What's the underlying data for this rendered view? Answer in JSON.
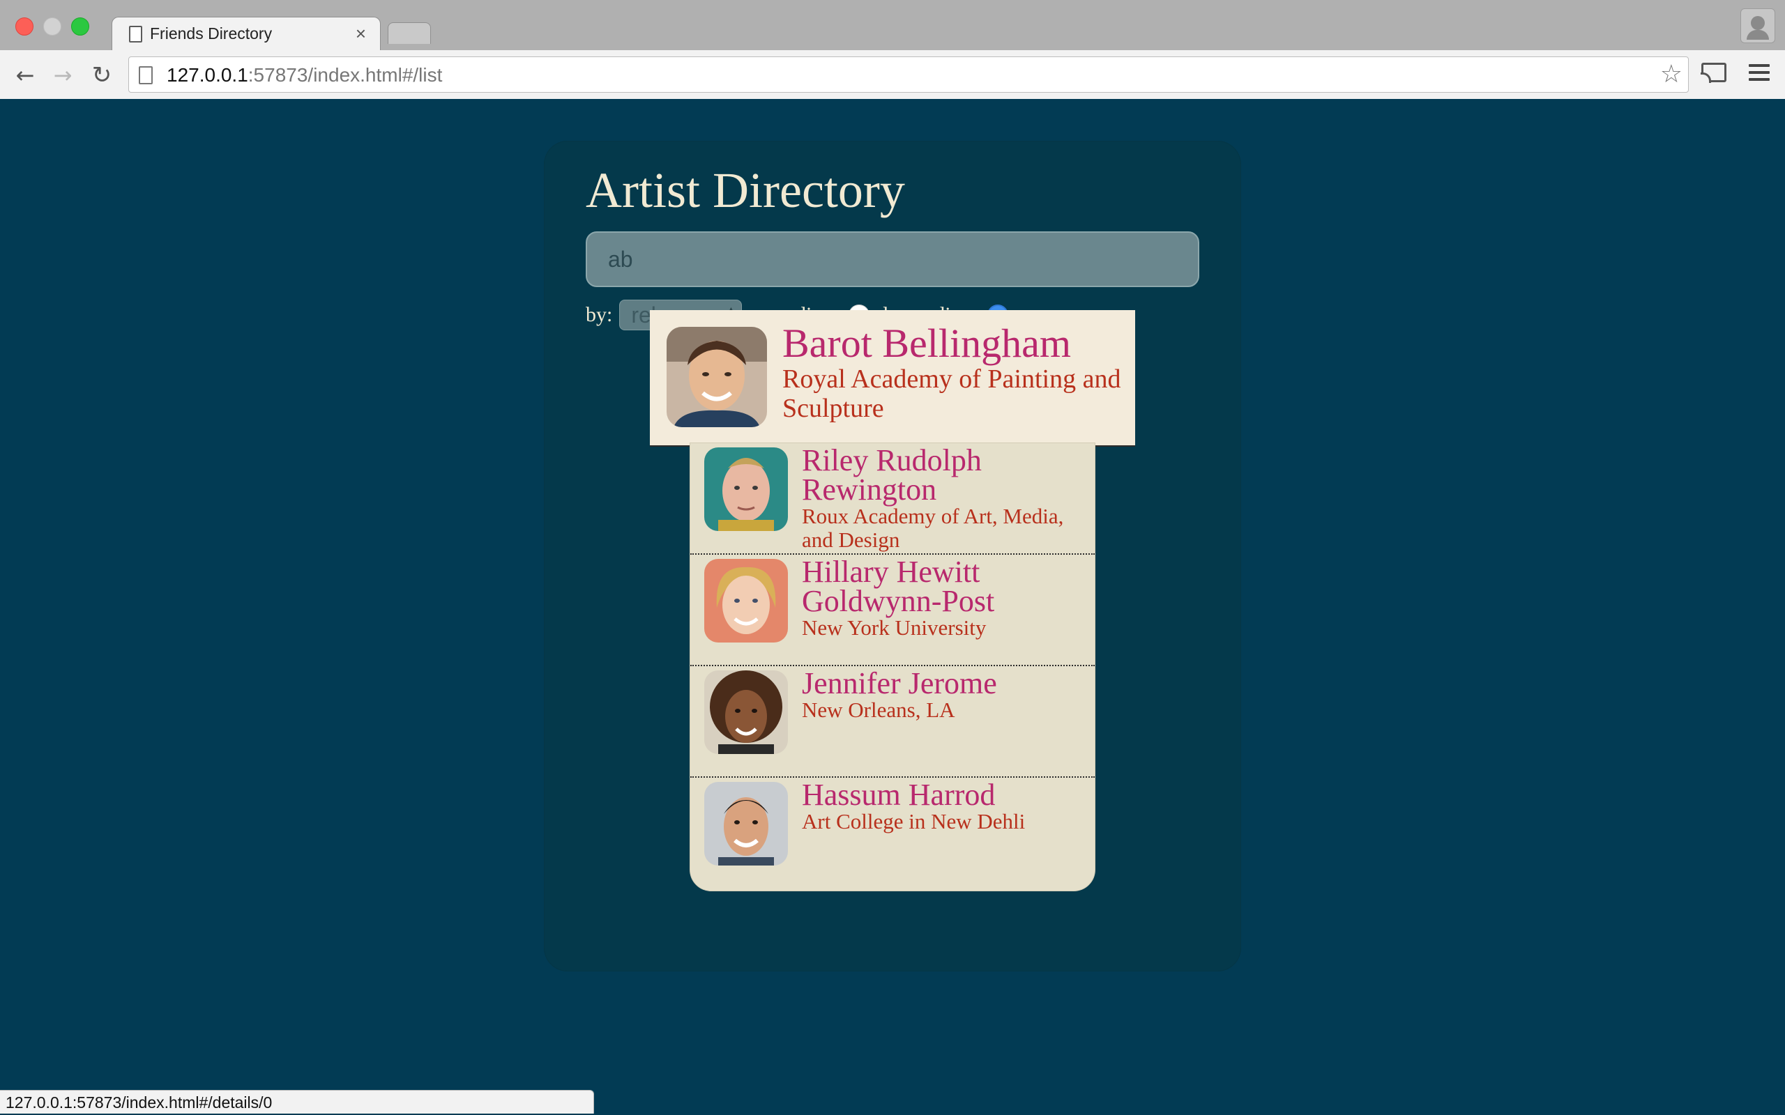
{
  "browser": {
    "tab_title": "Friends Directory",
    "tab_close": "×",
    "url_host": "127.0.0.1",
    "url_rest": ":57873/index.html#/list",
    "status_url": "127.0.0.1:57873/index.html#/details/0",
    "icons": [
      "back-arrow-icon",
      "forward-arrow-icon",
      "reload-icon",
      "page-icon",
      "star-icon",
      "cast-icon",
      "menu-icon",
      "profile-icon"
    ]
  },
  "app": {
    "title": "Artist Directory",
    "search": {
      "value": "ab",
      "placeholder": ""
    },
    "sort": {
      "by_label": "by:",
      "selected": "reknown",
      "ascending_label": "ascending:",
      "descending_label": "descending:",
      "order": "descending"
    },
    "artists": [
      {
        "name": "Barot Bellingham",
        "reknown": "Royal Academy of Painting and Sculpture"
      },
      {
        "name": "Riley Rudolph Rewington",
        "reknown": "Roux Academy of Art, Media, and Design"
      },
      {
        "name": "Hillary Hewitt Goldwynn-Post",
        "reknown": "New York University"
      },
      {
        "name": "Jennifer Jerome",
        "reknown": "New Orleans, LA"
      },
      {
        "name": "Hassum Harrod",
        "reknown": "Art College in New Dehli"
      }
    ]
  },
  "colors": {
    "page_bg": "#023b54",
    "panel_bg": "#04394b",
    "title": "#f1ead3",
    "name": "#b8286d",
    "reknown": "#b8301c",
    "list_bg": "#e5e0cb",
    "hover_bg": "#f3ebdb"
  }
}
